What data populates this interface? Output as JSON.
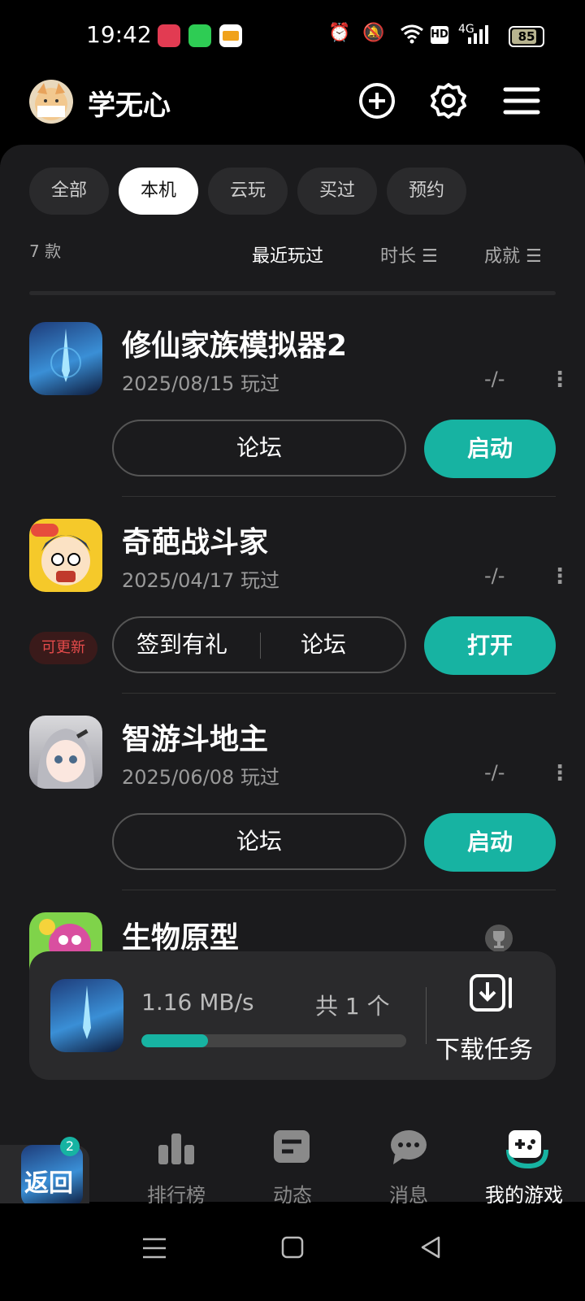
{
  "status_bar": {
    "time": "19:42",
    "network": "4G",
    "hd": "HD",
    "battery": "85"
  },
  "header": {
    "username": "学无心",
    "icons": [
      "plus-icon",
      "settings-icon",
      "menu-icon"
    ]
  },
  "tabs": [
    {
      "label": "全部",
      "active": false
    },
    {
      "label": "本机",
      "active": true
    },
    {
      "label": "云玩",
      "active": false
    },
    {
      "label": "买过",
      "active": false
    },
    {
      "label": "预约",
      "active": false
    }
  ],
  "list_meta": {
    "count": "7 款",
    "sort_recent": "最近玩过",
    "sort_duration": "时长",
    "sort_achievement": "成就"
  },
  "games": [
    {
      "title": "修仙家族模拟器2",
      "date": "2025/08/15 玩过",
      "score": "-/-",
      "buttons": [
        "论坛"
      ],
      "action": "启动"
    },
    {
      "title": "奇葩战斗家",
      "date": "2025/04/17 玩过",
      "score": "-/-",
      "badge": "可更新",
      "buttons": [
        "签到有礼",
        "论坛"
      ],
      "action": "打开"
    },
    {
      "title": "智游斗地主",
      "date": "2025/06/08 玩过",
      "score": "-/-",
      "buttons": [
        "论坛"
      ],
      "action": "启动"
    },
    {
      "title": "生物原型"
    }
  ],
  "download": {
    "speed": "1.16 MB/s",
    "count": "共 1 个",
    "progress": 0.25,
    "task_label": "下载任务"
  },
  "bottom_nav": [
    {
      "label": "排行榜"
    },
    {
      "label": "动态"
    },
    {
      "label": "消息"
    },
    {
      "label": "我的游戏",
      "active": true
    }
  ],
  "back_button": {
    "label": "返回",
    "badge": "2"
  },
  "colors": {
    "accent": "#17b3a2",
    "panel": "#1b1b1d",
    "badge_red": "#e54b4b"
  }
}
